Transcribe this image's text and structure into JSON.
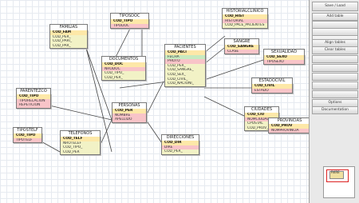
{
  "tables": {
    "familias": {
      "title": "FAMILIAS",
      "rows": [
        "COD_FAM",
        "COD_PER_",
        "COD_PARI_",
        "COD_PAR_"
      ]
    },
    "tiposdoc": {
      "title": "TIPOSDOC",
      "rows": [
        "COD_TIPO",
        "TIPODOC"
      ]
    },
    "historial": {
      "title": "HISTORIALCLINICO",
      "rows": [
        "COD_HIST",
        "HISTORIAL",
        "COD_PACE_PACIENTES"
      ]
    },
    "pacientes": {
      "title": "PACIENTES",
      "rows": [
        "COD_PACI",
        "FECHA",
        "PHOTO",
        "COD_PER_",
        "COD_SANGRE_",
        "COD_SEX_",
        "COD_CIVIL_",
        "COD_NACIONI_"
      ]
    },
    "sangre": {
      "title": "SANGRE",
      "rows": [
        "COD_SANGRE",
        "CLASE"
      ]
    },
    "sexualidad": {
      "title": "SEXUALIDAD",
      "rows": [
        "COD_SEXO",
        "TIPOSEXO"
      ]
    },
    "documentos": {
      "title": "DOCUMENTOS",
      "rows": [
        "COD_DOC",
        "NRODOC",
        "COD_TIPO_",
        "COD_PER_"
      ]
    },
    "estadocivil": {
      "title": "ESTADOCIVIL",
      "rows": [
        "COD_CIVIL",
        "ESTADO"
      ]
    },
    "parentezco": {
      "title": "PARENTEZCO",
      "rows": [
        "COD_TIPO",
        "TIPORELACION",
        "REPETICION"
      ]
    },
    "personas": {
      "title": "PERSONAS",
      "rows": [
        "COD_PER",
        "NOMBRE",
        "APELLIDO"
      ]
    },
    "ciudades": {
      "title": "CIUDADES",
      "rows": [
        "COD_CIU",
        "NOMCIUDAD",
        "CPOSTAL",
        "COD_PROV_"
      ]
    },
    "provincias": {
      "title": "PROVINCIAS",
      "rows": [
        "COD_PROV",
        "NOMPROVINCIA"
      ]
    },
    "tipotelf": {
      "title": "TIPOSTELF",
      "rows": [
        "COD_TIPO",
        "TIPOTELF"
      ]
    },
    "telefonos": {
      "title": "TELEFONOS",
      "rows": [
        "COD_TELF",
        "NROTELEF",
        "COD_TIPO_",
        "COD_PER"
      ]
    },
    "direcciones": {
      "title": "DIRECCIONES",
      "rows": [
        "COD_DIR",
        "DIRE",
        "COD_PER_"
      ]
    }
  },
  "panel": {
    "save_load": "Save / Load",
    "add_table": "Add table",
    "edit_table": "",
    "btn4": "",
    "btn5": "",
    "align_tables": "Align tables",
    "clear_tables": "Clear tables",
    "btn8": "",
    "btn9": "",
    "btn10": "",
    "btn11": "",
    "btn12": "",
    "options": "Options",
    "documentation": "Documentation"
  },
  "minimap": {
    "label": "RKRE"
  }
}
